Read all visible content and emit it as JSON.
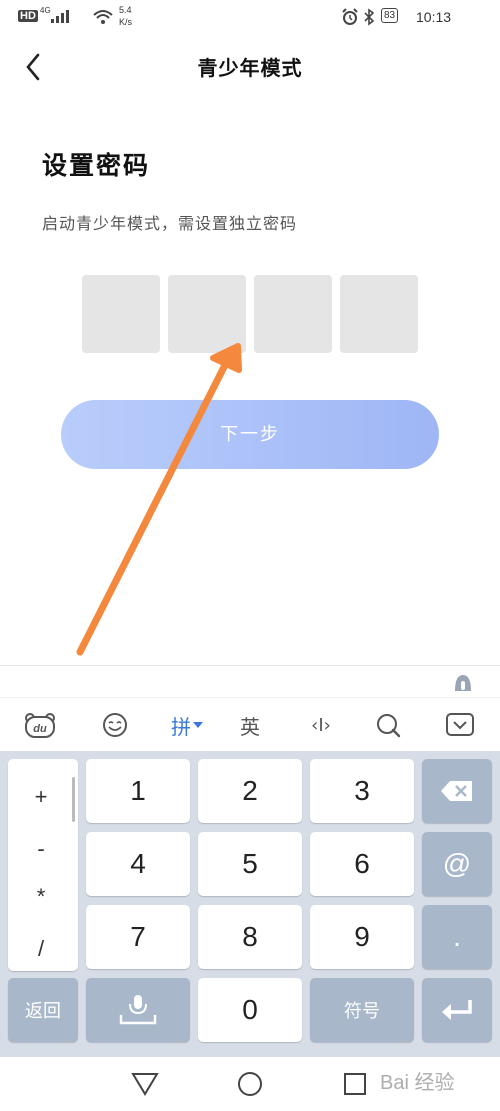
{
  "status_bar": {
    "hd": "HD",
    "network": "4G",
    "speed_value": "5.4",
    "speed_unit": "K/s",
    "battery": "83",
    "time": "10:13"
  },
  "header": {
    "title": "青少年模式"
  },
  "main": {
    "heading": "设置密码",
    "subtitle": "启动青少年模式，需设置独立密码",
    "pin_count": 4,
    "next_label": "下一步"
  },
  "keyboard": {
    "toolbar": {
      "pinyin": "拼",
      "english": "英",
      "cursor": "‹I›"
    },
    "symbols": [
      "+",
      "-",
      "*",
      "/"
    ],
    "digits": [
      "1",
      "2",
      "3",
      "4",
      "5",
      "6",
      "7",
      "8",
      "9",
      "0"
    ],
    "at_key": "@",
    "dot_key": ".",
    "back_label": "返回",
    "symbols_label": "符号"
  },
  "watermark": "Bai 经验",
  "colors": {
    "accent": "#3a78d8",
    "button_gradient_start": "#b9cdfb",
    "button_gradient_end": "#9fb6f6",
    "arrow": "#f4883c",
    "keyboard_bg": "#d7dde6",
    "fn_key": "#a9b7cb"
  }
}
